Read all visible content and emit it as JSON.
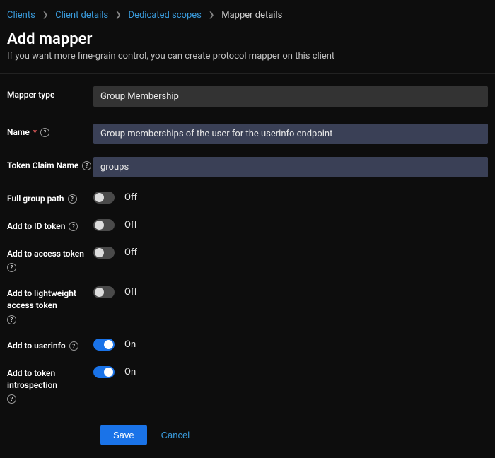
{
  "breadcrumb": {
    "items": [
      {
        "label": "Clients",
        "link": true
      },
      {
        "label": "Client details",
        "link": true
      },
      {
        "label": "Dedicated scopes",
        "link": true
      },
      {
        "label": "Mapper details",
        "link": false
      }
    ]
  },
  "header": {
    "title": "Add mapper",
    "subtitle": "If you want more fine-grain control, you can create protocol mapper on this client"
  },
  "form": {
    "mapper_type": {
      "label": "Mapper type",
      "value": "Group Membership"
    },
    "name": {
      "label": "Name",
      "value": "Group memberships of the user for the userinfo endpoint"
    },
    "token_claim_name": {
      "label": "Token Claim Name",
      "value": "groups"
    },
    "full_group_path": {
      "label": "Full group path",
      "state": "Off",
      "on": false
    },
    "add_id_token": {
      "label": "Add to ID token",
      "state": "Off",
      "on": false
    },
    "add_access_token": {
      "label": "Add to access token",
      "state": "Off",
      "on": false
    },
    "add_lightweight": {
      "label": "Add to lightweight access token",
      "state": "Off",
      "on": false
    },
    "add_userinfo": {
      "label": "Add to userinfo",
      "state": "On",
      "on": true
    },
    "add_introspection": {
      "label": "Add to token introspection",
      "state": "On",
      "on": true
    }
  },
  "actions": {
    "save": "Save",
    "cancel": "Cancel"
  }
}
